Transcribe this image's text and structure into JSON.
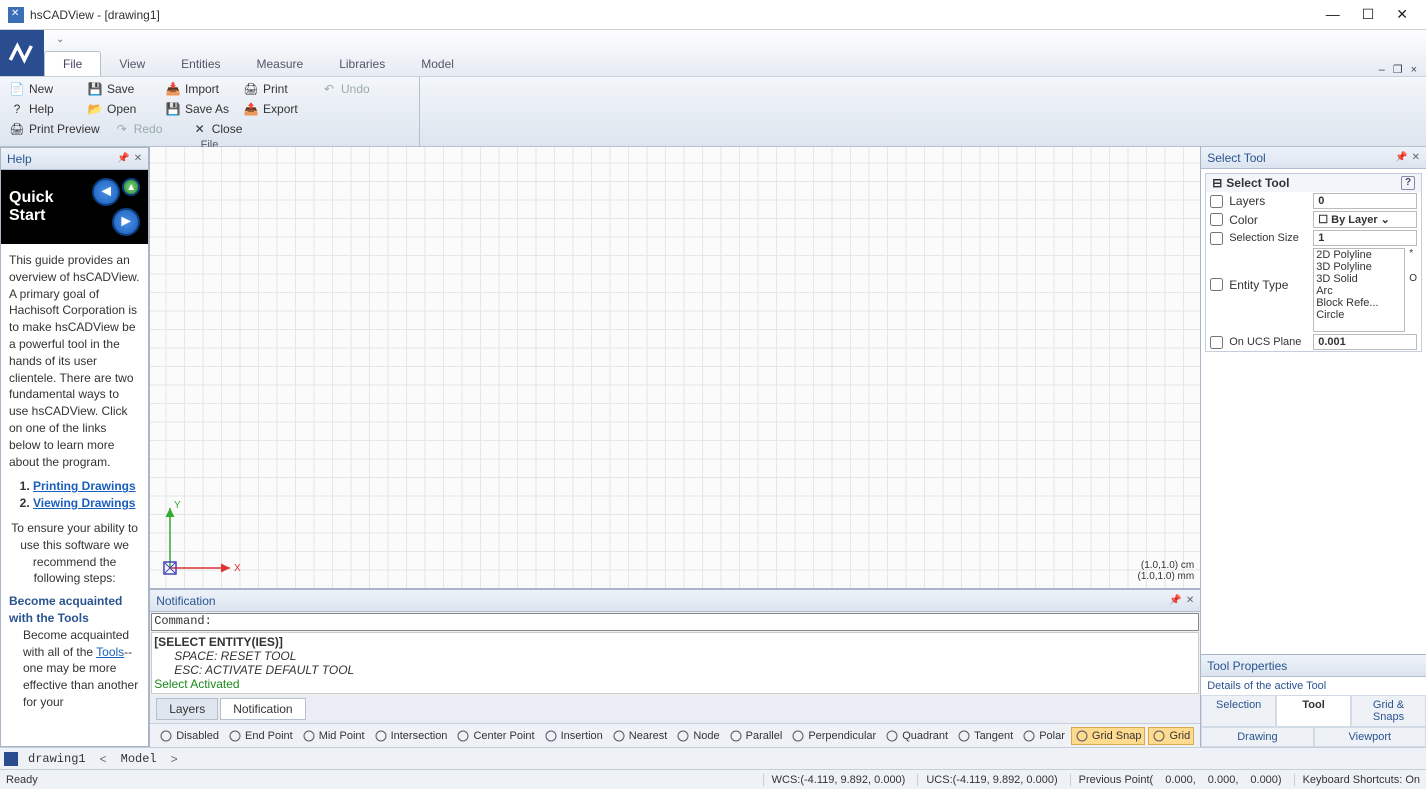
{
  "title": "hsCADView - [drawing1]",
  "menu_tabs": [
    "File",
    "View",
    "Entities",
    "Measure",
    "Libraries",
    "Model"
  ],
  "active_tab": 0,
  "ribbon": {
    "group_label": "File",
    "items": [
      {
        "icon": "📄",
        "label": "New"
      },
      {
        "icon": "💾",
        "label": "Save"
      },
      {
        "icon": "📥",
        "label": "Import"
      },
      {
        "icon": "🖨",
        "label": "Print"
      },
      {
        "icon": "↶",
        "label": "Undo",
        "disabled": true
      },
      {
        "icon": "?",
        "label": "Help"
      },
      {
        "icon": "📂",
        "label": "Open"
      },
      {
        "icon": "💾",
        "label": "Save As"
      },
      {
        "icon": "📤",
        "label": "Export"
      },
      {
        "icon": "🖨",
        "label": "Print Preview"
      },
      {
        "icon": "↷",
        "label": "Redo",
        "disabled": true
      },
      {
        "icon": "✕",
        "label": "Close"
      }
    ]
  },
  "help_panel": {
    "title": "Help",
    "header": "Quick Start",
    "body": "This guide provides an overview of hsCADView. A primary goal of Hachisoft Corporation is to make hsCADView be a powerful tool in the hands of its user clientele. There are two fundamental ways to use hsCADView. Click on one of the links below to learn more about the program.",
    "links": [
      "Printing Drawings",
      "Viewing Drawings"
    ],
    "ensure": "To ensure your ability to use this software we recommend the following steps:",
    "sub_heading": "Become acquainted with the Tools",
    "sub_desc_1": "Become acquainted with all of the ",
    "sub_link": "Tools",
    "sub_desc_2": "--one may be more effective than another for your"
  },
  "canvas": {
    "units1": "(1.0,1.0) cm",
    "units2": "(1.0,1.0) mm",
    "x": "X",
    "y": "Y"
  },
  "notification": {
    "title": "Notification",
    "prompt": "Command:",
    "line1": "[SELECT ENTITY(IES)]",
    "line2": "SPACE: RESET TOOL",
    "line3": "ESC: ACTIVATE DEFAULT TOOL",
    "line4": "Select Activated"
  },
  "bottom_tabs": [
    "Layers",
    "Notification"
  ],
  "snap_items": [
    {
      "label": "Disabled"
    },
    {
      "label": "End Point"
    },
    {
      "label": "Mid Point"
    },
    {
      "label": "Intersection"
    },
    {
      "label": "Center Point"
    },
    {
      "label": "Insertion"
    },
    {
      "label": "Nearest"
    },
    {
      "label": "Node"
    },
    {
      "label": "Parallel"
    },
    {
      "label": "Perpendicular"
    },
    {
      "label": "Quadrant"
    },
    {
      "label": "Tangent"
    },
    {
      "label": "Polar"
    },
    {
      "label": "Grid Snap",
      "on": true
    },
    {
      "label": "Grid",
      "on": true
    }
  ],
  "select_tool": {
    "title": "Select Tool",
    "group": "Select Tool",
    "layers_lbl": "Layers",
    "layers_val": "0",
    "color_lbl": "Color",
    "color_val": "By Layer",
    "selsize_lbl": "Selection Size",
    "selsize_val": "1",
    "entity_lbl": "Entity Type",
    "entities": [
      "2D Polyline",
      "3D Polyline",
      "3D Solid",
      "Arc",
      "Block Refe...",
      "Circle"
    ],
    "onucs_lbl": "On UCS Plane",
    "onucs_val": "0.001"
  },
  "props": {
    "title": "Tool Properties",
    "desc": "Details of the active Tool",
    "tabs": [
      "Selection",
      "Tool",
      "Grid & Snaps",
      "Drawing",
      "Viewport"
    ]
  },
  "doc_tabs": {
    "drawing": "drawing1",
    "model": "Model"
  },
  "status": {
    "ready": "Ready",
    "wcs": "WCS:(-4.119, 9.892, 0.000)",
    "ucs": "UCS:(-4.119, 9.892, 0.000)",
    "prev_lbl": "Previous Point(",
    "p1": "0.000,",
    "p2": "0.000,",
    "p3": "0.000)",
    "shortcuts": "Keyboard Shortcuts: On"
  }
}
